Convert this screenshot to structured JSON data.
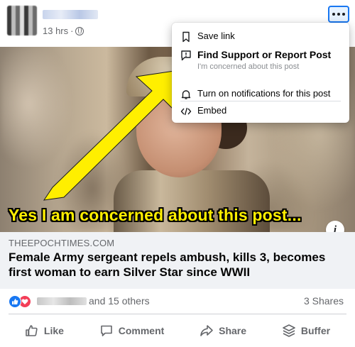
{
  "post": {
    "timestamp": "13 hrs",
    "privacy_icon": "globe-icon",
    "more_icon": "more-options-icon"
  },
  "menu": {
    "save_link": "Save link",
    "report": "Find Support or Report Post",
    "report_sub": "I'm concerned about this post",
    "notifications": "Turn on notifications for this post",
    "embed": "Embed"
  },
  "image": {
    "caption": "Yes I am concerned about this post...",
    "info_label": "i",
    "arrow_color": "#ffef00"
  },
  "link_preview": {
    "domain": "THEEPOCHTIMES.COM",
    "headline": "Female Army sergeant repels ambush, kills 3, becomes first woman to earn Silver Star since WWII"
  },
  "reactions": {
    "others_text": "and 15 others",
    "shares_text": "3 Shares",
    "like_color": "#1877f2",
    "love_color": "#f33e58"
  },
  "actions": {
    "like": "Like",
    "comment": "Comment",
    "share": "Share",
    "buffer": "Buffer"
  }
}
